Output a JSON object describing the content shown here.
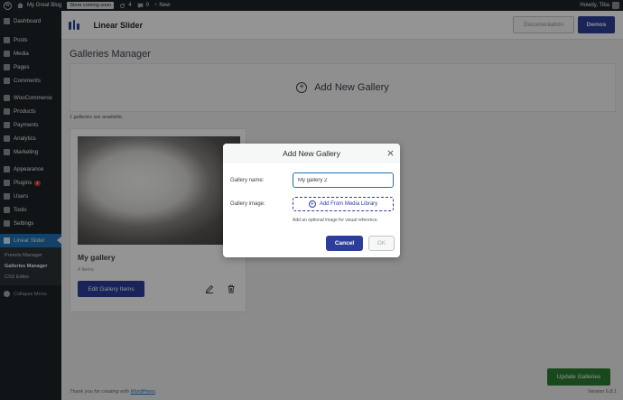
{
  "adminbar": {
    "site_name": "My Great Blog",
    "store_badge": "Store coming soon",
    "updates_count": "4",
    "comments_count": "0",
    "new_label": "New",
    "howdy": "Howdy, Tiba"
  },
  "sidebar": {
    "items": [
      {
        "label": "Dashboard",
        "icon": "dashboard-icon"
      },
      {
        "label": "Posts",
        "icon": "pin-icon"
      },
      {
        "label": "Media",
        "icon": "media-icon"
      },
      {
        "label": "Pages",
        "icon": "page-icon"
      },
      {
        "label": "Comments",
        "icon": "comment-icon"
      },
      {
        "label": "WooCommerce",
        "icon": "woo-icon"
      },
      {
        "label": "Products",
        "icon": "products-icon"
      },
      {
        "label": "Payments",
        "icon": "payments-icon"
      },
      {
        "label": "Analytics",
        "icon": "analytics-icon"
      },
      {
        "label": "Marketing",
        "icon": "marketing-icon"
      },
      {
        "label": "Appearance",
        "icon": "appearance-icon"
      },
      {
        "label": "Plugins",
        "icon": "plugins-icon",
        "badge": "1"
      },
      {
        "label": "Users",
        "icon": "users-icon"
      },
      {
        "label": "Tools",
        "icon": "tools-icon"
      },
      {
        "label": "Settings",
        "icon": "settings-icon"
      },
      {
        "label": "Linear Slider",
        "icon": "slider-icon"
      }
    ],
    "submenu": [
      "Presets Manager",
      "Galleries Manager",
      "CSS Editor"
    ],
    "collapse_label": "Collapse Menu"
  },
  "header": {
    "title": "Linear Slider",
    "documentation_label": "Documentation",
    "demos_label": "Demos"
  },
  "main": {
    "page_title": "Galleries Manager",
    "add_gallery_label": "Add New Gallery",
    "count_note": "1 galleries are available.",
    "gallery": {
      "name": "My gallery",
      "items": "4 items",
      "edit_label": "Edit Gallery Items"
    }
  },
  "footer": {
    "thanks_prefix": "Thank you for creating with",
    "wordpress_link": "WordPress",
    "thanks_suffix": ".",
    "version": "Version 6.8.1",
    "update_label": "Update Galleries"
  },
  "modal": {
    "title": "Add New Gallery",
    "name_label": "Gallery name:",
    "name_value": "My gallery 2",
    "image_label": "Gallery image:",
    "media_button_label": "Add From Media Library",
    "hint": "Add an optional image for visual reference.",
    "cancel_label": "Cancel",
    "ok_label": "OK"
  },
  "colors": {
    "primary": "#2c3e9a",
    "admin_dark": "#1d2327",
    "admin_active": "#2271b1",
    "success": "#2e7d32"
  }
}
